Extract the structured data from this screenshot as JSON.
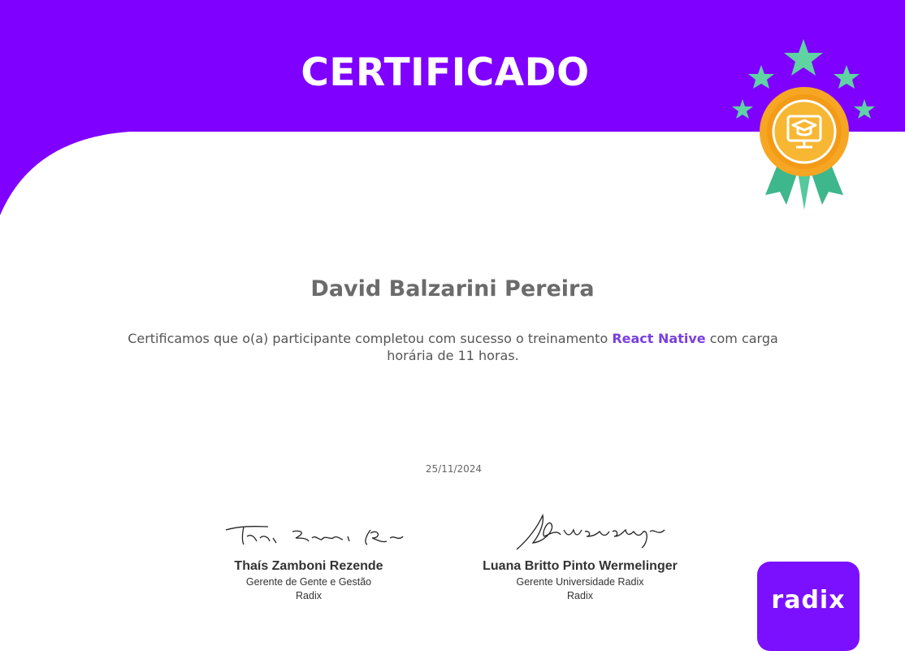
{
  "certificate": {
    "title": "CERTIFICADO",
    "participant_name": "David Balzarini Pereira",
    "description_before": "Certificamos que o(a) participante completou com sucesso o treinamento ",
    "course_name": "React Native",
    "description_after": " com carga horária de 11 horas.",
    "date": "25/11/2024"
  },
  "signatures": [
    {
      "name": "Thaís Zamboni Rezende",
      "role": "Gerente de Gente e Gestão",
      "org": "Radix"
    },
    {
      "name": "Luana Britto Pinto Wermelinger",
      "role": "Gerente Universidade Radix",
      "org": "Radix"
    }
  ],
  "logo": {
    "text": "radix"
  },
  "colors": {
    "brand_purple": "#7f00ff",
    "course_highlight": "#7a3fe0",
    "star_green": "#5fd3a2",
    "medal_orange": "#f6a623"
  },
  "icons": [
    "star-icon",
    "medal-icon",
    "graduation-monitor-icon"
  ]
}
